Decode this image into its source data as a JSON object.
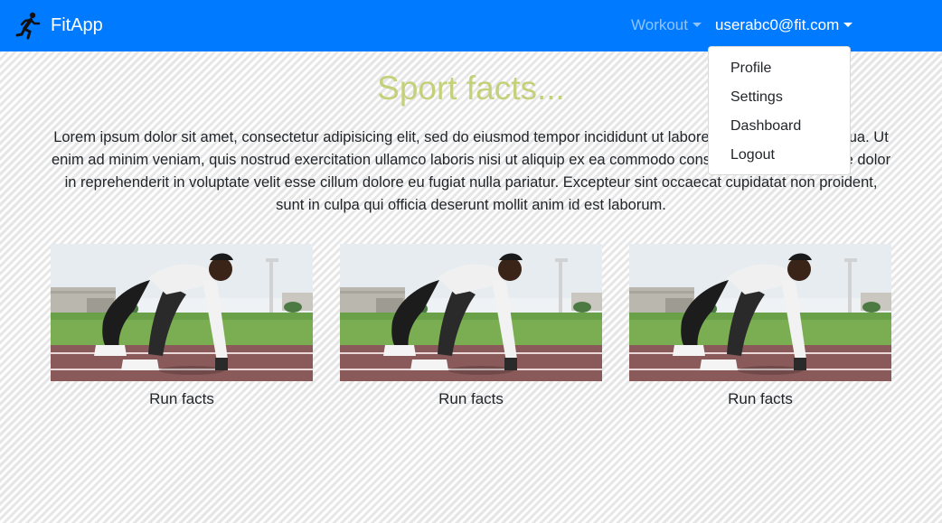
{
  "app": {
    "brand": "FitApp",
    "brand_icon": "running-man-icon"
  },
  "nav": {
    "workout_label": "Workout",
    "user_label": "userabc0@fit.com"
  },
  "dropdown": {
    "items": [
      "Profile",
      "Settings",
      "Dashboard",
      "Logout"
    ]
  },
  "main": {
    "heading": "Sport facts...",
    "paragraph": "Lorem ipsum dolor sit amet, consectetur adipisicing elit, sed do eiusmod tempor incididunt ut labore et dolore magna aliqua. Ut enim ad minim veniam, quis nostrud exercitation ullamco laboris nisi ut aliquip ex ea commodo consequat. Duis aute irure dolor in reprehenderit in voluptate velit esse cillum dolore eu fugiat nulla pariatur. Excepteur sint occaecat cupidatat non proident, sunt in culpa qui officia deserunt mollit anim id est laborum."
  },
  "cards": [
    {
      "caption": "Run facts",
      "image": "sprinter-start-photo"
    },
    {
      "caption": "Run facts",
      "image": "sprinter-start-photo"
    },
    {
      "caption": "Run facts",
      "image": "sprinter-start-photo"
    }
  ],
  "colors": {
    "navbar": "#007bff",
    "heading": "#c4d07a",
    "nav_muted": "rgba(255,255,255,0.55)"
  }
}
